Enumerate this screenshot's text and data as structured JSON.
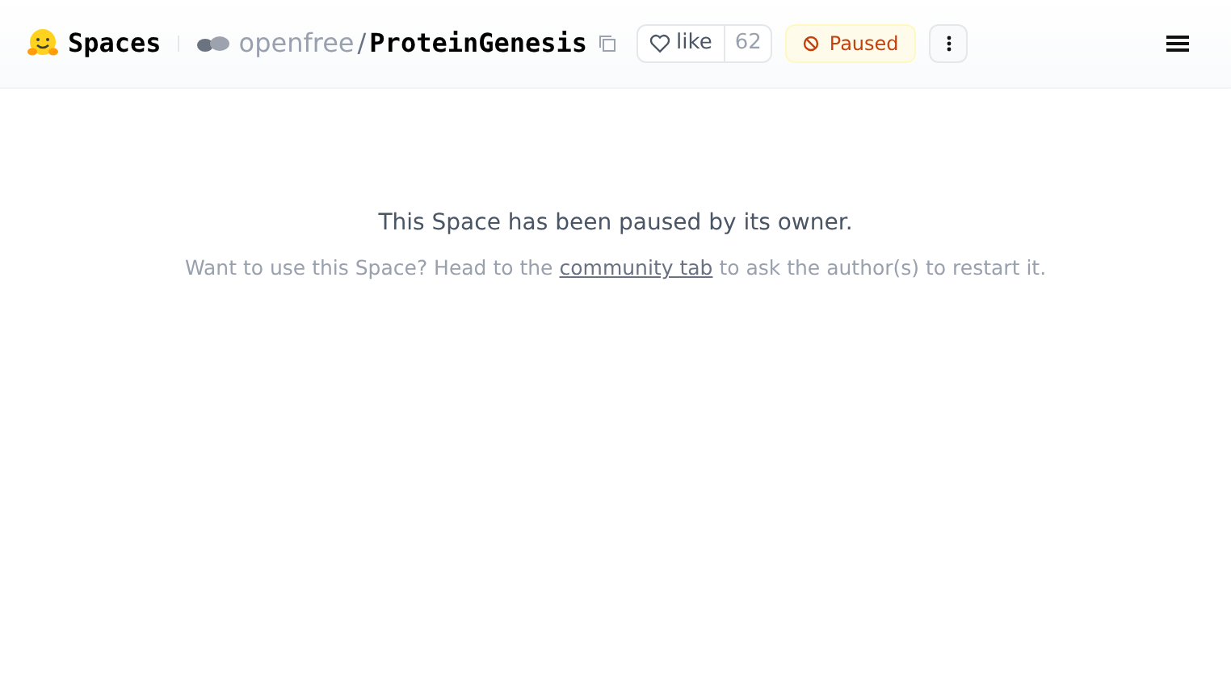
{
  "header": {
    "brand": "Spaces",
    "owner": "openfree",
    "separator": "/",
    "repo": "ProteinGenesis",
    "like_label": "like",
    "like_count": "62",
    "status": "Paused"
  },
  "notice": {
    "title": "This Space has been paused by its owner.",
    "before": "Want to use this Space? Head to the",
    "link": "community tab",
    "after": "to ask the author(s) to restart it."
  }
}
